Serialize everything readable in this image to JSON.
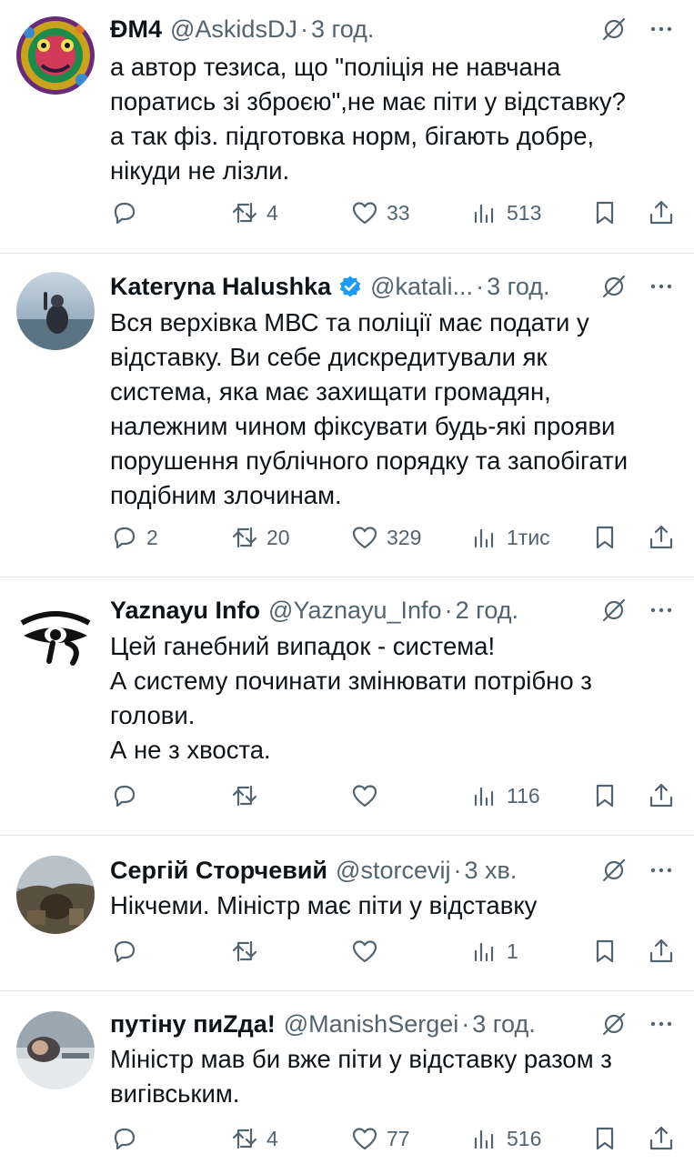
{
  "icons": {
    "reply": "reply-icon",
    "retweet": "retweet-icon",
    "like": "heart-icon",
    "views": "views-icon",
    "bookmark": "bookmark-icon",
    "share": "share-icon",
    "grok": "grok-icon",
    "more": "more-icon",
    "verified": "verified-badge-icon"
  },
  "colors": {
    "text": "#0f1419",
    "secondary": "#536471",
    "verified": "#1d9bf0",
    "divider": "#e6e9eb"
  },
  "tweets": [
    {
      "name": "ĐМ4",
      "handle": "@AskidsDJ",
      "separator": "·",
      "time": "3 год.",
      "lines": [
        "а автор тезиса, що \"поліція не навчана",
        "поратись зі зброєю\",не має піти у відставку?",
        "а так фіз. підготовка норм, бігають добре,",
        "нікуди не лізли."
      ],
      "replies": "",
      "retweets": "4",
      "likes": "33",
      "views": "513"
    },
    {
      "name": "Kateryna Halushka",
      "verified": true,
      "handle": "@katali...",
      "separator": "·",
      "time": "3 год.",
      "lines": [
        "Вся верхівка МВС та поліції має подати у",
        "відставку. Ви себе дискредитували як",
        "система, яка має захищати громадян,",
        "належним чином фіксувати будь-які прояви",
        "порушення публічного порядку та запобігати",
        "подібним злочинам."
      ],
      "replies": "2",
      "retweets": "20",
      "likes": "329",
      "views": "1тис"
    },
    {
      "name": "Yaznayu Info",
      "handle": "@Yaznayu_Info",
      "separator": "·",
      "time": "2 год.",
      "lines": [
        "Цей ганебний випадок - система!",
        "А систему починати змінювати потрібно з",
        "голови.",
        "А не з хвоста."
      ],
      "replies": "",
      "retweets": "",
      "likes": "",
      "views": "116"
    },
    {
      "name": "Сергій Сторчевий",
      "handle": "@storcevij",
      "separator": "·",
      "time": "3 хв.",
      "lines": [
        "Нікчеми. Міністр має піти у відставку"
      ],
      "replies": "",
      "retweets": "",
      "likes": "",
      "views": "1"
    },
    {
      "name": "путіну пиZда!",
      "handle": "@ManishSergei",
      "separator": "·",
      "time": "3 год.",
      "lines": [
        "Міністр мав би вже піти у відставку разом з",
        "вигівським."
      ],
      "replies": "",
      "retweets": "4",
      "likes": "77",
      "views": "516"
    }
  ]
}
